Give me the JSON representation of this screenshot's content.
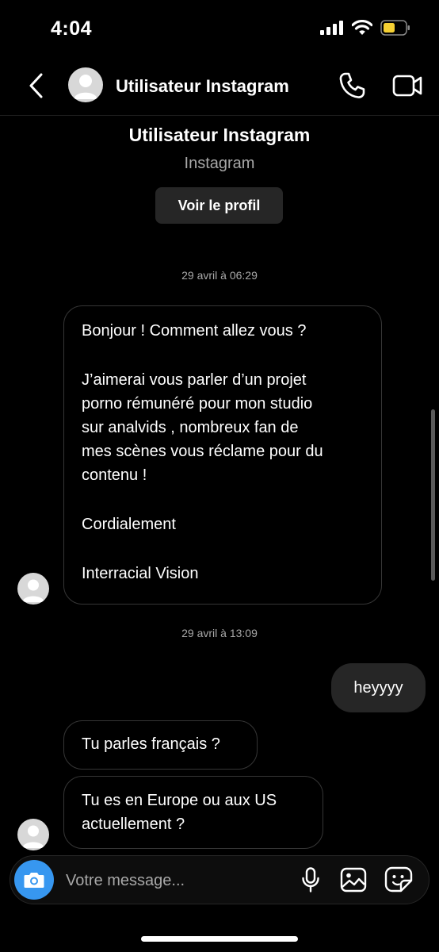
{
  "status_bar": {
    "time": "4:04"
  },
  "header": {
    "title": "Utilisateur Instagram"
  },
  "profile": {
    "name": "Utilisateur Instagram",
    "subtitle": "Instagram",
    "view_profile_label": "Voir le profil"
  },
  "messages": {
    "timestamp_1": "29 avril à 06:29",
    "message_1": {
      "line_1": "Bonjour ! Comment allez vous ?",
      "line_2": "J’aimerai vous parler d’un projet",
      "line_3": "porno rémunéré pour mon studio",
      "line_4": "sur analvids , nombreux fan de",
      "line_5": "mes scènes vous réclame pour du",
      "line_6": "contenu !",
      "line_7": "Cordialement",
      "line_8": "Interracial Vision"
    },
    "timestamp_2": "29 avril à 13:09",
    "message_2": "heyyyy",
    "message_3": "Tu parles français ?",
    "message_4": {
      "line_1": "Tu es en Europe ou aux US",
      "line_2": "actuellement ?"
    }
  },
  "composer": {
    "placeholder": "Votre message..."
  },
  "icons": {
    "back": "chevron-left-icon",
    "call": "phone-icon",
    "video": "video-camera-icon",
    "camera": "camera-icon",
    "mic": "microphone-icon",
    "gallery": "image-icon",
    "sticker": "sticker-icon"
  },
  "colors": {
    "background": "#000000",
    "bubble_outgoing": "#262626",
    "bubble_border": "#363636",
    "camera_button": "#3797f0",
    "secondary_text": "#a8a8a8",
    "battery": "#f5d033"
  }
}
